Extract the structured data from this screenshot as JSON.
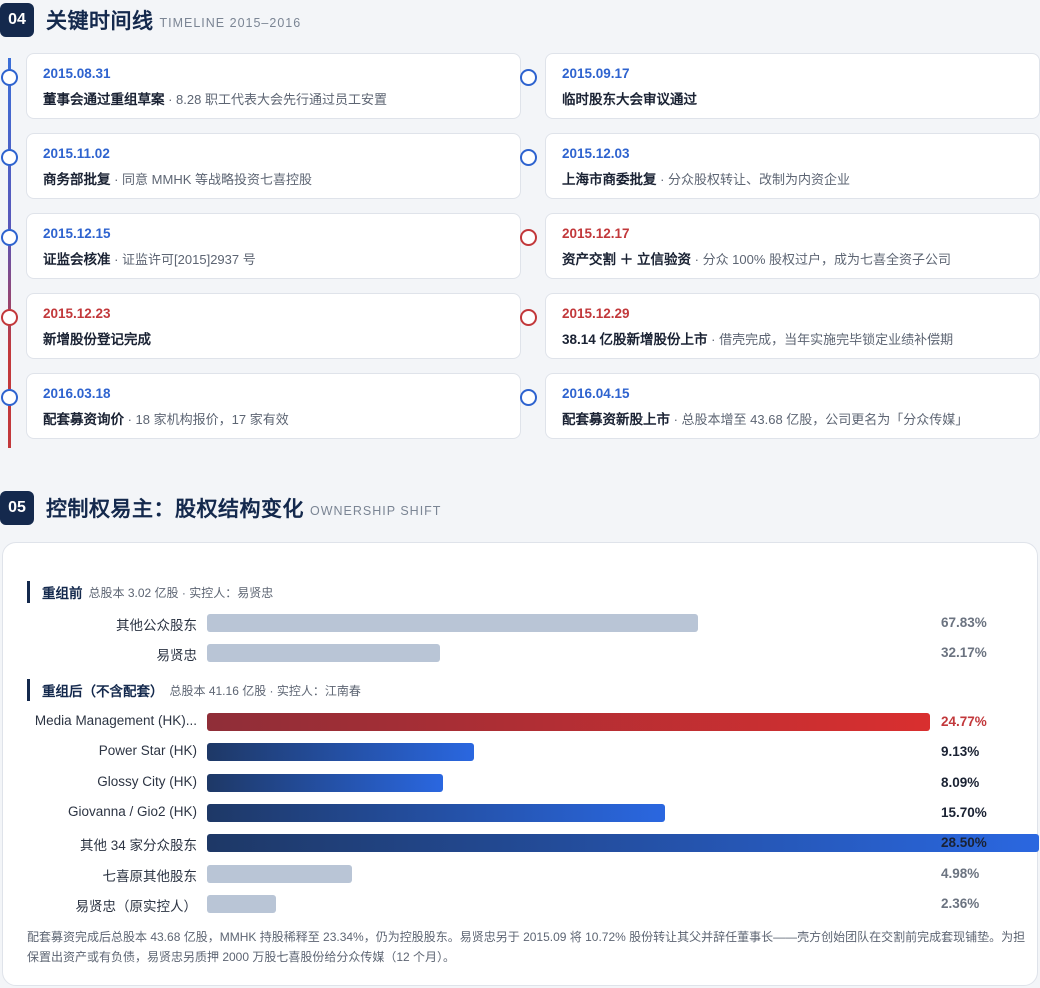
{
  "section4": {
    "num": "04",
    "title": "关键时间线",
    "subtitle": "TIMELINE 2015–2016",
    "events": [
      {
        "date": "2015.08.31",
        "title": "董事会通过重组草案",
        "detail": " · 8.28 职工代表大会先行通过员工安置",
        "color": "blue"
      },
      {
        "date": "2015.09.17",
        "title": "临时股东大会审议通过",
        "detail": "",
        "color": "blue"
      },
      {
        "date": "2015.11.02",
        "title": "商务部批复",
        "detail": " · 同意 MMHK 等战略投资七喜控股",
        "color": "blue"
      },
      {
        "date": "2015.12.03",
        "title": "上海市商委批复",
        "detail": " · 分众股权转让、改制为内资企业",
        "color": "blue"
      },
      {
        "date": "2015.12.15",
        "title": "证监会核准",
        "detail": " · 证监许可[2015]2937 号",
        "color": "blue"
      },
      {
        "date": "2015.12.17",
        "title": "资产交割 ＋ 立信验资",
        "detail": " · 分众 100% 股权过户，成为七喜全资子公司",
        "color": "red"
      },
      {
        "date": "2015.12.23",
        "title": "新增股份登记完成",
        "detail": "",
        "color": "red"
      },
      {
        "date": "2015.12.29",
        "title": "38.14 亿股新增股份上市",
        "detail": " · 借壳完成，当年实施完毕锁定业绩补偿期",
        "color": "red"
      },
      {
        "date": "2016.03.18",
        "title": "配套募资询价",
        "detail": " · 18 家机构报价，17 家有效",
        "color": "blue"
      },
      {
        "date": "2016.04.15",
        "title": "配套募资新股上市",
        "detail": " · 总股本增至 43.68 亿股，公司更名为「分众传媒」",
        "color": "blue"
      }
    ]
  },
  "section5": {
    "num": "05",
    "title": "控制权易主：股权结构变化",
    "subtitle": "OWNERSHIP SHIFT",
    "before": {
      "label": "重组前",
      "meta": "总股本 3.02 亿股 · 实控人：易贤忠",
      "rows": [
        {
          "name": "其他公众股东",
          "value": 67.83,
          "pct": "67.83%",
          "style": "gray"
        },
        {
          "name": "易贤忠",
          "value": 32.17,
          "pct": "32.17%",
          "style": "gray"
        }
      ]
    },
    "after": {
      "label": "重组后（不含配套）",
      "meta": "总股本 41.16 亿股 · 实控人：江南春",
      "rows": [
        {
          "name": "Media Management (HK)...",
          "value": 24.77,
          "pct": "24.77%",
          "style": "red"
        },
        {
          "name": "Power Star (HK)",
          "value": 9.13,
          "pct": "9.13%",
          "style": "blue"
        },
        {
          "name": "Glossy City (HK)",
          "value": 8.09,
          "pct": "8.09%",
          "style": "blue"
        },
        {
          "name": "Giovanna / Gio2 (HK)",
          "value": 15.7,
          "pct": "15.70%",
          "style": "blue"
        },
        {
          "name": "其他 34 家分众股东",
          "value": 28.5,
          "pct": "28.50%",
          "style": "blue"
        },
        {
          "name": "七喜原其他股东",
          "value": 4.98,
          "pct": "4.98%",
          "style": "gray"
        },
        {
          "name": "易贤忠（原实控人）",
          "value": 2.36,
          "pct": "2.36%",
          "style": "gray"
        }
      ]
    },
    "note": "配套募资完成后总股本 43.68 亿股，MMHK 持股稀释至 23.34%，仍为控股股东。易贤忠另于 2015.09 将 10.72% 股份转让其父并辞任董事长——壳方创始团队在交割前完成套现铺垫。为担保置出资产或有负债，易贤忠另质押 2000 万股七喜股份给分众传媒（12 个月）。"
  }
}
